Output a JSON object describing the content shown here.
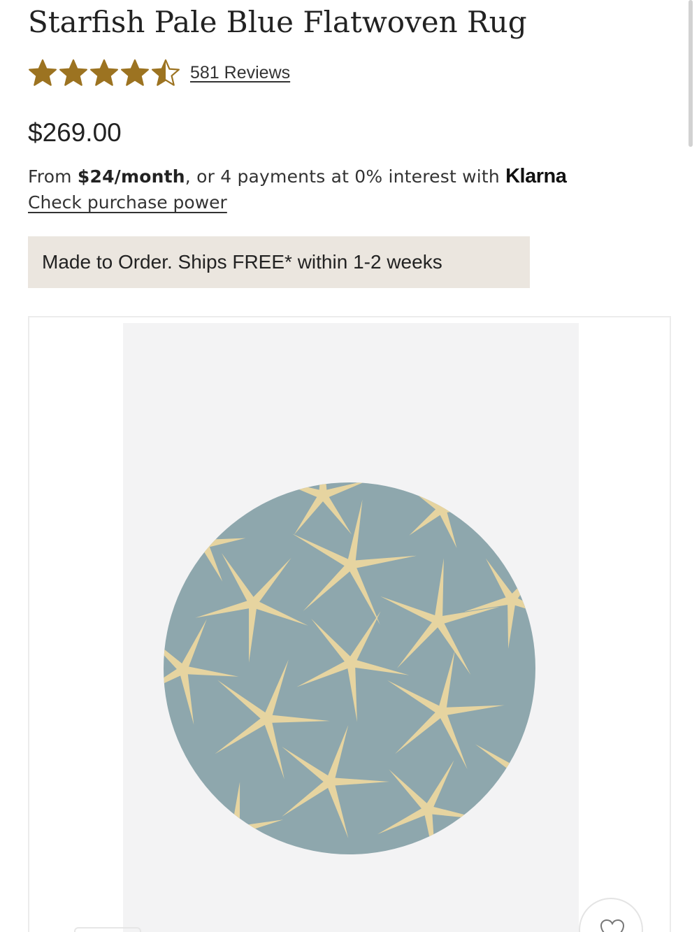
{
  "product": {
    "title": "Starfish Pale Blue Flatwoven Rug",
    "rating": 4.5,
    "rating_max": 5,
    "reviews_label": "581 Reviews",
    "price": "$269.00"
  },
  "klarna": {
    "prefix": "From ",
    "monthly": "$24/month",
    "middle": ", or 4 payments at 0% interest with ",
    "brand": "Klarna",
    "link": "Check purchase power"
  },
  "shipping": {
    "message": "Made to Order. Ships FREE* within 1-2 weeks"
  },
  "colors": {
    "star": "#9c7321",
    "banner_bg": "#ebe6df",
    "rug_base": "#8ea7ad",
    "starfish": "#e6d4a0"
  },
  "icons": {
    "rating": "star-icon",
    "wishlist": "heart-icon"
  }
}
